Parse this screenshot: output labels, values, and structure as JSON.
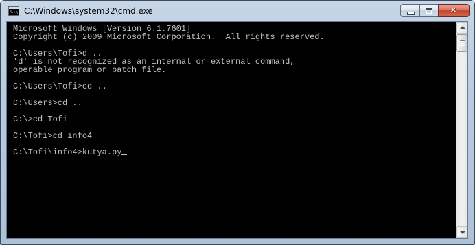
{
  "window": {
    "title": "C:\\Windows\\system32\\cmd.exe",
    "icon": "cmd-icon",
    "icon_text": "C:\\",
    "buttons": {
      "minimize": "minimize-icon",
      "maximize": "maximize-icon",
      "close": "close-icon",
      "close_glyph": "✕"
    }
  },
  "console": {
    "lines": [
      "Microsoft Windows [Version 6.1.7601]",
      "Copyright (c) 2009 Microsoft Corporation.  All rights reserved.",
      "",
      "C:\\Users\\Tofi>d ..",
      "'d' is not recognized as an internal or external command,",
      "operable program or batch file.",
      "",
      "C:\\Users\\Tofi>cd ..",
      "",
      "C:\\Users>cd ..",
      "",
      "C:\\>cd Tofi",
      "",
      "C:\\Tofi>cd info4",
      "",
      "C:\\Tofi\\info4>kutya.py"
    ],
    "text_color": "#c0c0c0",
    "background_color": "#000000"
  }
}
